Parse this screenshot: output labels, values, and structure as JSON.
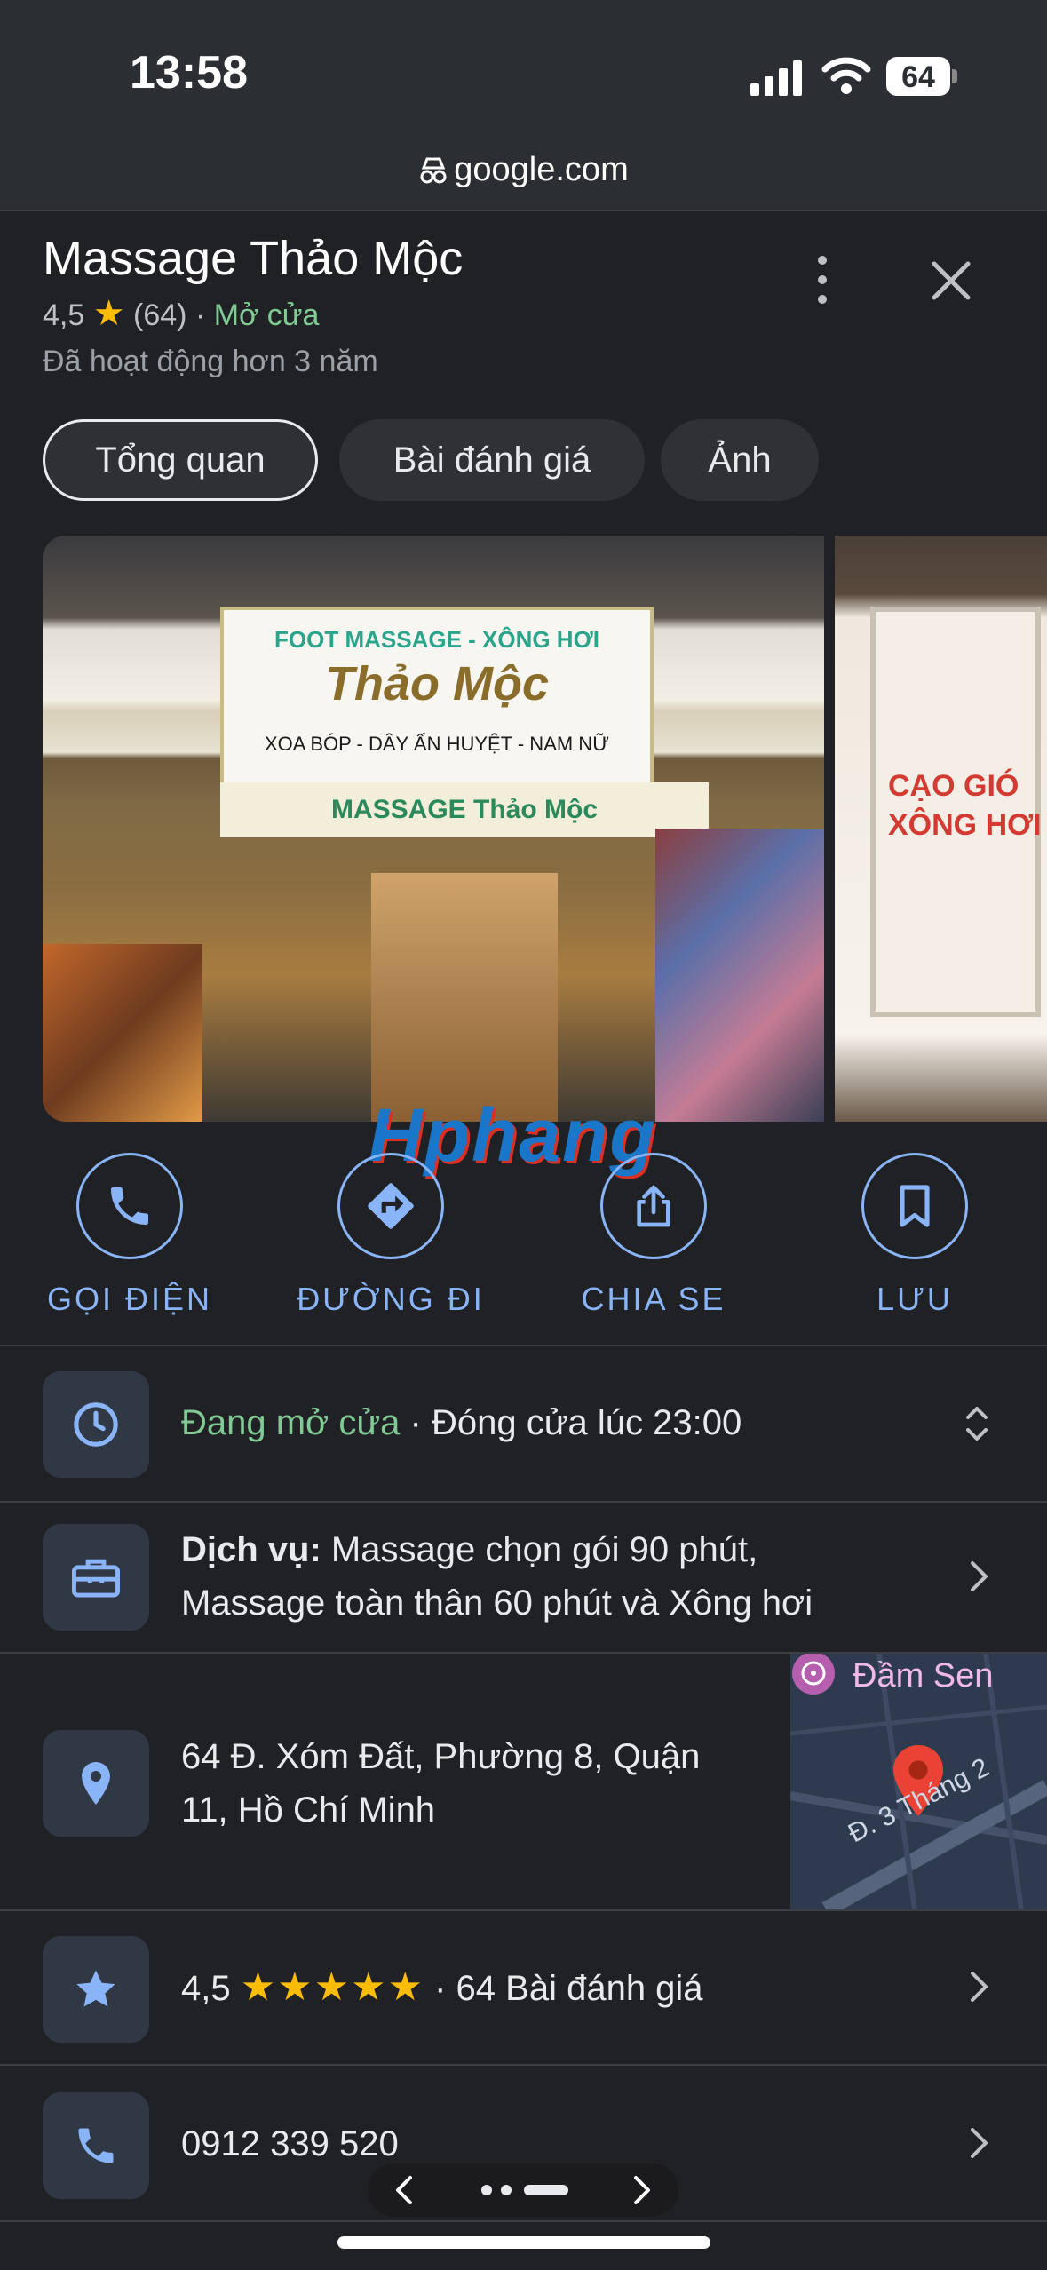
{
  "status_bar": {
    "time": "13:58",
    "battery": "64"
  },
  "url_bar": {
    "domain": "google.com"
  },
  "place": {
    "name": "Massage Thảo Mộc",
    "rating": "4,5",
    "review_count": "(64)",
    "separator": "·",
    "open_status": "Mở cửa",
    "since": "Đã hoạt động hơn 3 năm"
  },
  "tabs": [
    {
      "label": "Tổng quan",
      "active": true
    },
    {
      "label": "Bài đánh giá",
      "active": false
    },
    {
      "label": "Ảnh",
      "active": false
    }
  ],
  "photo": {
    "sign_line1": "FOOT MASSAGE - XÔNG HƠI",
    "sign_line2": "Thảo Mộc",
    "sign_line3": "XOA BÓP - DÂY ẤN HUYỆT - NAM NỮ",
    "banner": "MASSAGE Thảo Mộc",
    "photo2_text": "CẠO GIÓ XÔNG HƠI"
  },
  "watermark": "Hphang",
  "actions": [
    {
      "label": "GỌI ĐIỆN",
      "icon": "phone-icon"
    },
    {
      "label": "ĐƯỜNG ĐI",
      "icon": "directions-icon"
    },
    {
      "label": "CHIA SE",
      "icon": "share-icon"
    },
    {
      "label": "LƯU",
      "icon": "bookmark-icon"
    }
  ],
  "hours": {
    "open_now": "Đang mở cửa",
    "separator": " · ",
    "closes": "Đóng cửa lúc 23:00"
  },
  "services": {
    "label": "Dịch vụ:",
    "line1": " Massage chọn gói 90 phút,",
    "line2": "Massage toàn thân 60 phút và Xông hơi"
  },
  "address": {
    "line1": "64 Đ. Xóm Đất, Phường 8, Quận",
    "line2": "11, Hồ Chí Minh"
  },
  "map": {
    "place_label": "Đầm Sen",
    "street_label": "Đ. 3 Tháng 2",
    "pin_color": "#ea4335"
  },
  "reviews": {
    "rating": "4,5",
    "stars": "★★★★★",
    "separator": "·",
    "count_text": "64 Bài đánh giá"
  },
  "phone": {
    "number": "0912 339 520"
  },
  "colors": {
    "accent": "#8ab4f8",
    "open_green": "#81c995",
    "star": "#fbbc04",
    "background": "#202124"
  }
}
